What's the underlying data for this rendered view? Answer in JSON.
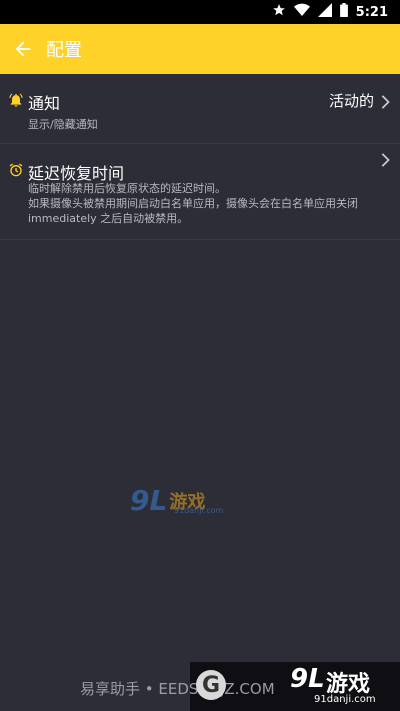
{
  "status_bar": {
    "time": "5:21",
    "icons": [
      "star-icon",
      "wifi-icon",
      "signal-icon",
      "battery-icon"
    ]
  },
  "app_bar": {
    "title": "配置",
    "back_icon": "arrow-left-icon",
    "background": "#ffd22a"
  },
  "settings": [
    {
      "icon": "bell-icon",
      "title": "通知",
      "subtitle": "显示/隐藏通知",
      "value": "活动的"
    },
    {
      "icon": "alarm-clock-icon",
      "title": "延迟恢复时间",
      "subtitle": "临时解除禁用后恢复原状态的延迟时间。\n如果摄像头被禁用期间启动白名单应用，摄像头会在白名单应用关闭 immediately 之后自动被禁用。"
    }
  ],
  "watermarks": {
    "center": {
      "logo": "9L",
      "name": "游戏",
      "url": "91danji.com"
    },
    "bottom_left": "易享助手 • EEDSHZJZ.COM",
    "bottom_right": {
      "logo": "9L",
      "name": "游戏",
      "url": "91danji.com"
    }
  },
  "colors": {
    "accent": "#ffd22a",
    "background": "#2d2d37"
  }
}
